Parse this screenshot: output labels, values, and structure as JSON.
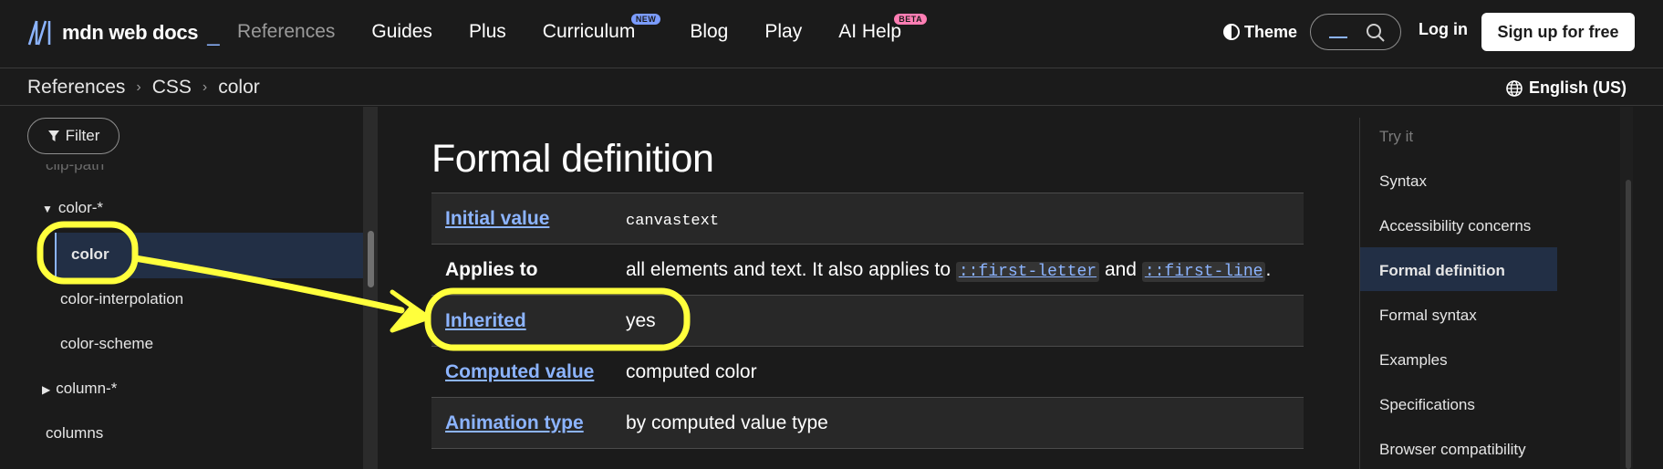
{
  "brand": {
    "logo_text": "mdn web docs",
    "logo_suffix": "_"
  },
  "nav": {
    "items": [
      {
        "label": "References",
        "active": true
      },
      {
        "label": "Guides"
      },
      {
        "label": "Plus"
      },
      {
        "label": "Curriculum",
        "badge": "NEW"
      },
      {
        "label": "Blog"
      },
      {
        "label": "Play"
      },
      {
        "label": "AI Help",
        "badge": "BETA"
      }
    ],
    "theme_label": "Theme",
    "login_label": "Log in",
    "signup_label": "Sign up for free"
  },
  "breadcrumb": {
    "items": [
      "References",
      "CSS",
      "color"
    ]
  },
  "language": "English (US)",
  "sidebar": {
    "filter_label": "Filter",
    "items": [
      {
        "label": "clip-path"
      },
      {
        "label": "color-*",
        "expanded": true
      },
      {
        "label": "color",
        "active": true
      },
      {
        "label": "color-interpolation"
      },
      {
        "label": "color-scheme"
      },
      {
        "label": "column-*",
        "expanded": false
      },
      {
        "label": "columns"
      }
    ]
  },
  "main": {
    "heading": "Formal definition",
    "rows": [
      {
        "key": "Initial value",
        "value": "canvastext"
      },
      {
        "key": "Applies to",
        "value_prefix": "all elements and text. It also applies to ",
        "code1": "::first-letter",
        "value_mid": " and ",
        "code2": "::first-line",
        "value_suffix": "."
      },
      {
        "key": "Inherited",
        "value": "yes"
      },
      {
        "key": "Computed value",
        "value": "computed color"
      },
      {
        "key": "Animation type",
        "value": "by computed value type"
      }
    ]
  },
  "toc": {
    "items": [
      {
        "label": "Try it"
      },
      {
        "label": "Syntax"
      },
      {
        "label": "Accessibility concerns"
      },
      {
        "label": "Formal definition",
        "active": true
      },
      {
        "label": "Formal syntax"
      },
      {
        "label": "Examples"
      },
      {
        "label": "Specifications"
      },
      {
        "label": "Browser compatibility"
      }
    ]
  },
  "colors": {
    "background": "#1b1b1b",
    "link": "#8cb4ff",
    "active_bg": "#222f45",
    "highlight_annotation": "#ffff3c"
  }
}
